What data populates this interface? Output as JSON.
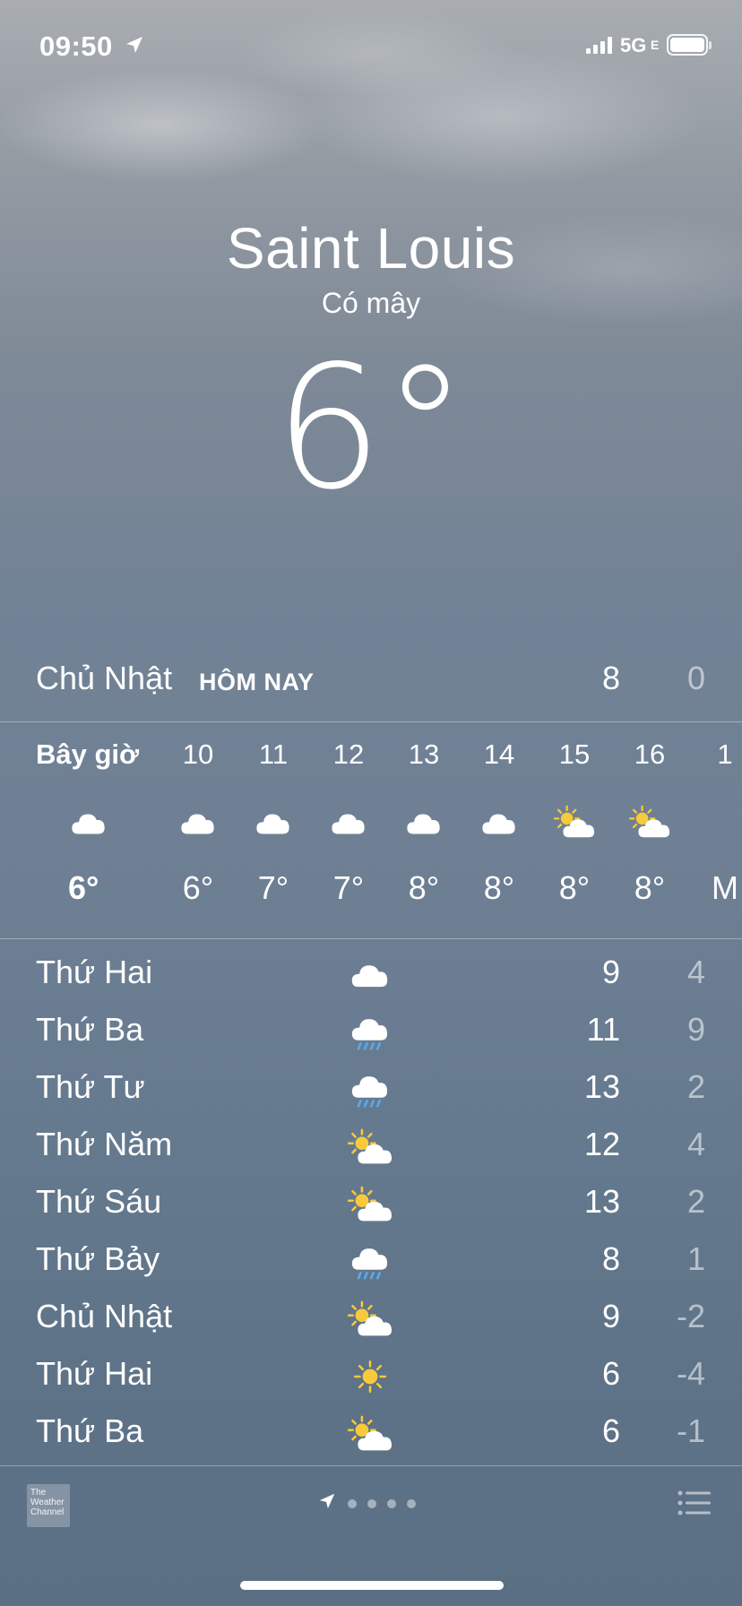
{
  "status_bar": {
    "time": "09:50",
    "network": "5G",
    "network_suffix": "E"
  },
  "header": {
    "city": "Saint Louis",
    "condition": "Có mây",
    "temperature": "6°"
  },
  "today": {
    "day": "Chủ Nhật",
    "tag": "HÔM NAY",
    "high": "8",
    "low": "0"
  },
  "hourly": [
    {
      "label": "Bây giờ",
      "icon": "cloud-icon",
      "temp": "6°"
    },
    {
      "label": "10",
      "icon": "cloud-icon",
      "temp": "6°"
    },
    {
      "label": "11",
      "icon": "cloud-icon",
      "temp": "7°"
    },
    {
      "label": "12",
      "icon": "cloud-icon",
      "temp": "7°"
    },
    {
      "label": "13",
      "icon": "cloud-icon",
      "temp": "8°"
    },
    {
      "label": "14",
      "icon": "cloud-icon",
      "temp": "8°"
    },
    {
      "label": "15",
      "icon": "partly-sunny-icon",
      "temp": "8°"
    },
    {
      "label": "16",
      "icon": "partly-sunny-icon",
      "temp": "8°"
    },
    {
      "label": "1",
      "icon": "",
      "temp": "M"
    }
  ],
  "daily": [
    {
      "day": "Thứ Hai",
      "icon": "cloud-icon",
      "high": "9",
      "low": "4"
    },
    {
      "day": "Thứ Ba",
      "icon": "rain-icon",
      "high": "11",
      "low": "9"
    },
    {
      "day": "Thứ Tư",
      "icon": "rain-icon",
      "high": "13",
      "low": "2"
    },
    {
      "day": "Thứ Năm",
      "icon": "partly-sunny-icon",
      "high": "12",
      "low": "4"
    },
    {
      "day": "Thứ Sáu",
      "icon": "partly-sunny-icon",
      "high": "13",
      "low": "2"
    },
    {
      "day": "Thứ Bảy",
      "icon": "rain-icon",
      "high": "8",
      "low": "1"
    },
    {
      "day": "Chủ Nhật",
      "icon": "partly-sunny-icon",
      "high": "9",
      "low": "-2"
    },
    {
      "day": "Thứ Hai",
      "icon": "sun-icon",
      "high": "6",
      "low": "-4"
    },
    {
      "day": "Thứ Ba",
      "icon": "partly-sunny-icon",
      "high": "6",
      "low": "-1"
    }
  ],
  "footer": {
    "logo_text": "The Weather Channel",
    "page_count": 5,
    "current_page_icon": "location-arrow-icon"
  },
  "colors": {
    "sun": "#f8c93a",
    "rain": "#5aa9f0",
    "cloud": "#ffffff"
  }
}
